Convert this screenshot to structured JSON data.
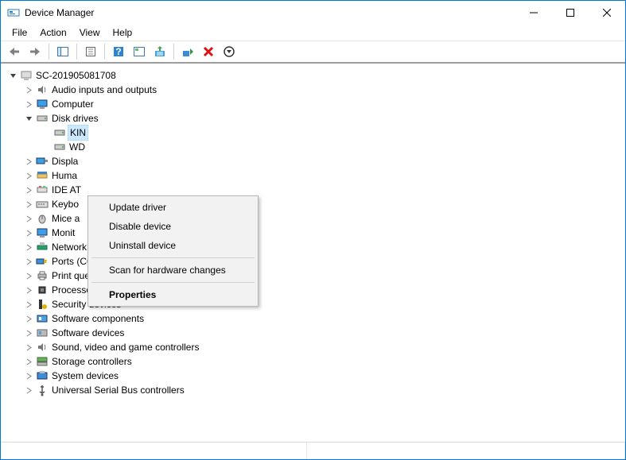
{
  "window": {
    "title": "Device Manager"
  },
  "menu": {
    "file": "File",
    "action": "Action",
    "view": "View",
    "help": "Help"
  },
  "tree": {
    "root": "SC-201905081708",
    "audio": "Audio inputs and outputs",
    "computer": "Computer",
    "disk": "Disk drives",
    "disk_child1_visible": "KIN",
    "disk_child2_visible": "WD",
    "display": "Displa",
    "hid": "Huma",
    "ide": "IDE AT",
    "keyboards": "Keybo",
    "mice": "Mice a",
    "monitors": "Monit",
    "network": "Network adapters",
    "ports": "Ports (COM & LPT)",
    "printqueues": "Print queues",
    "processors": "Processors",
    "security": "Security devices",
    "swcomponents": "Software components",
    "swdevices": "Software devices",
    "sound": "Sound, video and game controllers",
    "storage": "Storage controllers",
    "system": "System devices",
    "usb": "Universal Serial Bus controllers"
  },
  "context_menu": {
    "update": "Update driver",
    "disable": "Disable device",
    "uninstall": "Uninstall device",
    "scan": "Scan for hardware changes",
    "properties": "Properties"
  }
}
